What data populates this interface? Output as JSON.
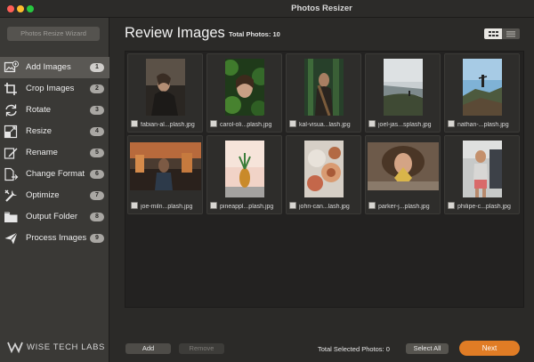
{
  "window": {
    "title": "Photos Resizer"
  },
  "sidebar": {
    "wizard_button": "Photos Resize Wizard",
    "items": [
      {
        "label": "Add Images",
        "badge": "1",
        "icon": "add-image-icon",
        "active": true
      },
      {
        "label": "Crop Images",
        "badge": "2",
        "icon": "crop-icon",
        "active": false
      },
      {
        "label": "Rotate",
        "badge": "3",
        "icon": "rotate-icon",
        "active": false
      },
      {
        "label": "Resize",
        "badge": "4",
        "icon": "resize-icon",
        "active": false
      },
      {
        "label": "Rename",
        "badge": "5",
        "icon": "rename-icon",
        "active": false
      },
      {
        "label": "Change Format",
        "badge": "6",
        "icon": "change-format-icon",
        "active": false
      },
      {
        "label": "Optimize",
        "badge": "7",
        "icon": "optimize-icon",
        "active": false
      },
      {
        "label": "Output Folder",
        "badge": "8",
        "icon": "folder-icon",
        "active": false
      },
      {
        "label": "Process Images",
        "badge": "9",
        "icon": "process-icon",
        "active": false
      }
    ],
    "brand": "WISE TECH LABS"
  },
  "main": {
    "title": "Review Images",
    "total_photos": "Total Photos: 10",
    "view_modes": [
      "grid-view-icon",
      "list-view-icon"
    ],
    "photos": [
      {
        "name": "fabian-al...plash.jpg",
        "checked": false
      },
      {
        "name": "carol-oli...plash.jpg",
        "checked": false
      },
      {
        "name": "kal-visua...lash.jpg",
        "checked": false
      },
      {
        "name": "joel-jas...splash.jpg",
        "checked": false
      },
      {
        "name": "nathan-...plash.jpg",
        "checked": false
      },
      {
        "name": "joe-miln...plash.jpg",
        "checked": false
      },
      {
        "name": "pineappl...plash.jpg",
        "checked": false
      },
      {
        "name": "john-can...lash.jpg",
        "checked": false
      },
      {
        "name": "parker-j...plash.jpg",
        "checked": false
      },
      {
        "name": "philipe-c...plash.jpg",
        "checked": false
      }
    ]
  },
  "footer": {
    "add_button": "Add",
    "remove_button": "Remove",
    "selected_label": "Total Selected Photos: 0",
    "select_all_button": "Select All",
    "next_button": "Next"
  },
  "colors": {
    "accent": "#e07c25",
    "sidebar_bg": "#3a3936",
    "active_item_bg": "#5a5854",
    "content_bg": "#2b2a28"
  }
}
